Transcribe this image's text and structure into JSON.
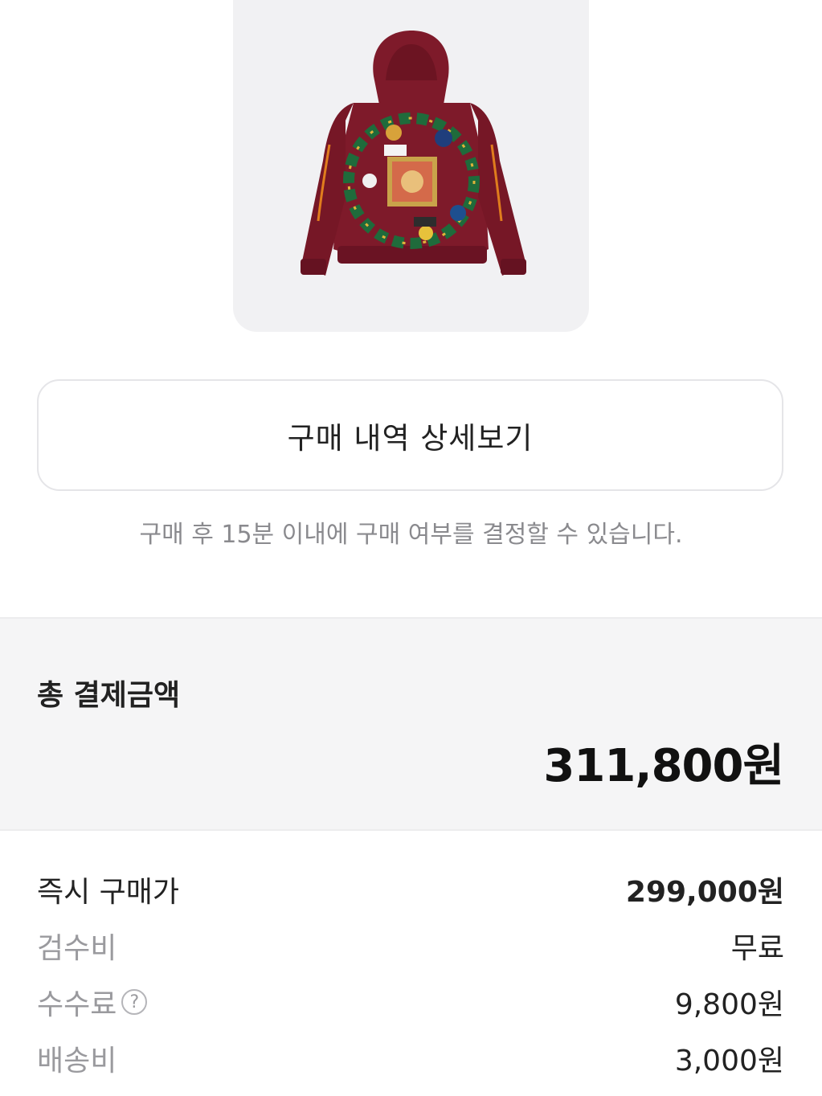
{
  "product": {
    "image_icon": "hoodie-back-image",
    "hoodie_color": "#7e1a2a"
  },
  "detail_button": {
    "label": "구매 내역 상세보기"
  },
  "notice": {
    "text": "구매 후 15분 이내에 구매 여부를 결정할 수 있습니다."
  },
  "total": {
    "label": "총 결제금액",
    "amount": "311,800원"
  },
  "breakdown": {
    "items": [
      {
        "label": "즉시 구매가",
        "value": "299,000원"
      },
      {
        "label": "검수비",
        "value": "무료"
      },
      {
        "label": "수수료",
        "value": "9,800원",
        "help_icon": "question-circle-icon",
        "help_symbol": "?"
      },
      {
        "label": "배송비",
        "value": "3,000원"
      }
    ]
  }
}
